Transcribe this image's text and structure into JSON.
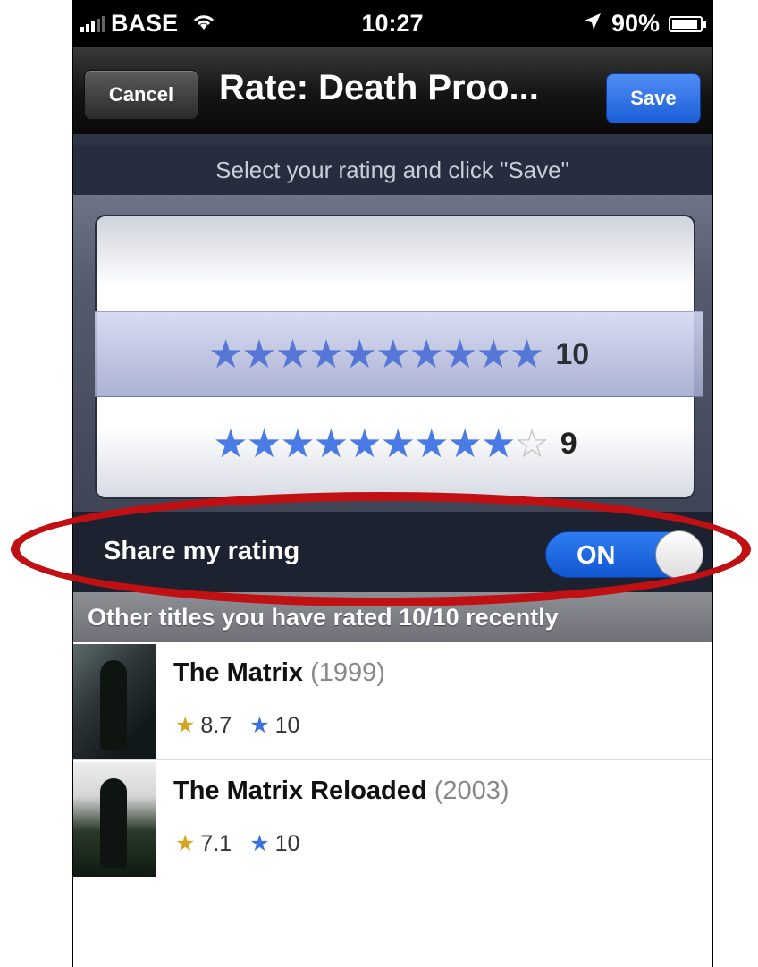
{
  "status_bar": {
    "carrier": "BASE",
    "time": "10:27",
    "battery": "90%"
  },
  "nav": {
    "cancel_label": "Cancel",
    "title": "Rate: Death Proo...",
    "save_label": "Save"
  },
  "instruction": "Select your rating and click \"Save\"",
  "picker": {
    "selected_value": "10",
    "rows": [
      {
        "stars_full": "★★★★★★★★★★",
        "stars_empty": "",
        "value": "10"
      },
      {
        "stars_full": "★★★★★★★★★",
        "stars_empty": "☆",
        "value": "9"
      }
    ]
  },
  "share": {
    "label": "Share my rating",
    "toggle_state": "ON"
  },
  "section_header": "Other titles you have rated 10/10 recently",
  "list": [
    {
      "title": "The Matrix",
      "year": "(1999)",
      "imdb_rating": "8.7",
      "user_rating": "10"
    },
    {
      "title": "The Matrix Reloaded",
      "year": "(2003)",
      "imdb_rating": "7.1",
      "user_rating": "10"
    }
  ],
  "colors": {
    "accent_blue": "#1c5fd8",
    "highlight_red": "#c01014",
    "star_gold": "#d7a524",
    "star_blue": "#3a70e0"
  }
}
